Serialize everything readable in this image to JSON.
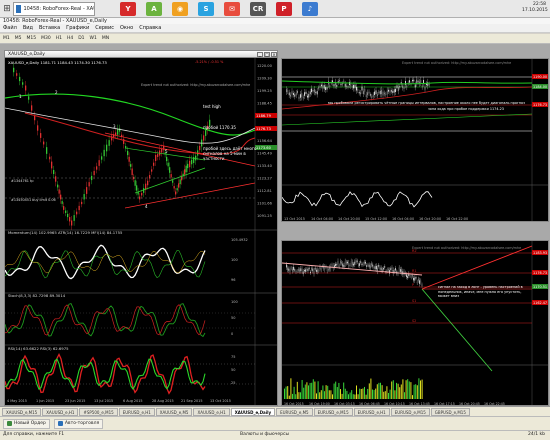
{
  "taskbar": {
    "window_label": "10458: RoboForex-Real - XAUUSD_e,Daily",
    "icons": [
      {
        "name": "yandex-icon",
        "glyph": "Y",
        "color": "#d62a2a"
      },
      {
        "name": "android-icon",
        "glyph": "A",
        "color": "#6cb33f"
      },
      {
        "name": "browser-icon",
        "glyph": "◉",
        "color": "#f0a020"
      },
      {
        "name": "skype-icon",
        "glyph": "S",
        "color": "#2aa3e0"
      },
      {
        "name": "mail-icon",
        "glyph": "✉",
        "color": "#e84c3d"
      },
      {
        "name": "cr-icon",
        "glyph": "CR",
        "color": "#555555"
      },
      {
        "name": "pinterest-icon",
        "glyph": "P",
        "color": "#cf2028"
      },
      {
        "name": "music-icon",
        "glyph": "♪",
        "color": "#3c7bd0"
      }
    ],
    "clock_time": "22:58",
    "clock_date": "17.10.2015"
  },
  "window": {
    "title": "10458: RoboForex-Real - XAUUSD_e,Daily"
  },
  "menu": [
    "Файл",
    "Вид",
    "Вставка",
    "Графики",
    "Сервис",
    "Окно",
    "Справка"
  ],
  "toolbar": [
    "M1",
    "M5",
    "M15",
    "M30",
    "H1",
    "H4",
    "D1",
    "W1",
    "MN"
  ],
  "chart_main": {
    "title": "XAUUSD_e,Daily",
    "ohlc": "XAUUSD_e,Daily  1181.71 1184.43 1174.30 1176.73",
    "loss_tag": "-5.21% / -0.51 %",
    "note_top": "Expert  trend  not  authorized: http://my.abuzarcodalsee.com/mhe",
    "label_test_high": "test high",
    "label_breakout": "пробой 1170.35",
    "label_breakout_here": "пробой здесь даёт много сигналов на 5-мин в частности",
    "label_level1": "#1344761 tp",
    "label_level2": "#13450451 buy limit 0.06",
    "points": [
      "1",
      "2",
      "3",
      "4",
      "5"
    ],
    "price_ticks": [
      "1220.00",
      "1209.30",
      "1199.25",
      "1188.45",
      "1178.25",
      "1167.65",
      "1156.64",
      "1145.49",
      "1133.40",
      "1123.27",
      "1112.81",
      "1101.66",
      "1091.25"
    ],
    "price_tags": [
      {
        "value": "1186.79",
        "color": "#cc0000"
      },
      {
        "value": "1176.73",
        "color": "#cc0000"
      },
      {
        "value": "1173.60",
        "color": "#2a8f2a"
      }
    ],
    "x_labels": [
      "4 May 2015",
      "1 Jun 2015",
      "23 Jun 2015",
      "13 Jul 2015",
      "6 Aug 2015",
      "28 Aug 2015",
      "21 Sep 2015",
      "13 Oct 2015"
    ],
    "momentum_label": "Momentum(14) 102.9965  ATR(14) 16.7229  MFI(14) 84.1755",
    "momentum_ticks": [
      "105.4932",
      "100",
      "96"
    ],
    "stoch_label": "Stoch(8,3,3) 82.7298 89.3014",
    "stoch_ticks": [
      "100",
      "50",
      "0"
    ],
    "rsi_label": "RSI(14) 63.6622  RSI(3) 62.6975",
    "rsi_ticks": [
      "75",
      "50",
      "25"
    ]
  },
  "chart_top_right": {
    "note1": "мы пробовали регистрировать чётные границы интервалов, настроение около нее будет диагональ прогноз",
    "label_zone": "зона хода при пробое поддержки  1174.23",
    "note_top": "Expert  trend  not  authorized: http://my.abuzarcodalsee.com/mhe",
    "x_labels": [
      "13 Oct 2015",
      "14 Oct 04:00",
      "14 Oct 20:00",
      "15 Oct 12:00",
      "16 Oct 04:00",
      "16 Oct 20:00",
      "16 Oct 22:00"
    ],
    "price_tags": [
      {
        "value": "1190.00",
        "color": "#cc0000"
      },
      {
        "value": "1184.00",
        "color": "#2a8f2a"
      },
      {
        "value": "1176.73",
        "color": "#cc0000"
      }
    ]
  },
  "chart_bottom_right": {
    "note_top": "Expert  trend  not  authorized: http://my.abuzarcodalsee.com/mhe",
    "annotation": "сигнал на заход в лонг - уровень настроений в понедельник, иначе, мне нужно его упустить, может вниз",
    "x_labels": [
      "16 Oct 2015",
      "16 Oct 19:00",
      "16 Oct 03:15",
      "16 Oct 06:45",
      "16 Oct 10:15",
      "16 Oct 13:45",
      "16 Oct 17:15",
      "16 Oct 20:45",
      "16 Oct 22:45"
    ],
    "levels": [
      "R2",
      "R1",
      "P",
      "S1",
      "S2"
    ],
    "price_tags": [
      {
        "value": "1183.93",
        "color": "#cc0000"
      },
      {
        "value": "1176.73",
        "color": "#cc0000"
      },
      {
        "value": "1170.51",
        "color": "#2a8f2a"
      },
      {
        "value": "1162.47",
        "color": "#cc0000"
      }
    ]
  },
  "tabs": [
    "XAUUSD_e,M15",
    "XAUUSD_e,H1",
    "#SP500_e,M15",
    "EURUSD_e,H1",
    "XAUUSD_e,M5",
    "XAUUSD_e,H1",
    "XAUUSD_e,Daily",
    "EURUSD_e,M5",
    "EURUSD_e,M15",
    "EURUSD_e,H1",
    "EURUSD_e,M15",
    "GBPUSD_e,M15"
  ],
  "active_tab": "XAUUSD_e,Daily",
  "bottom_buttons": [
    {
      "label": "Новый Ордер",
      "color": "#3c8a3c"
    },
    {
      "label": "Авто-торговля",
      "color": "#2a6fb8"
    }
  ],
  "status": {
    "left": "Для справки, нажмите F1",
    "middle": "Валюты и фьючерсы",
    "right": "24/1 kb"
  }
}
